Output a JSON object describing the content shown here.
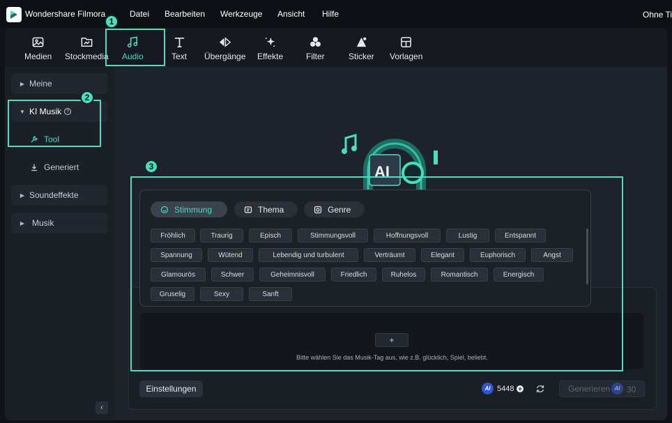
{
  "titlebar": {
    "app_title": "Wondershare Filmora",
    "menu": [
      "Datei",
      "Bearbeiten",
      "Werkzeuge",
      "Ansicht",
      "Hilfe"
    ],
    "right_title": "Ohne Tit"
  },
  "toolbar": {
    "items": [
      {
        "label": "Medien",
        "icon": "media-icon"
      },
      {
        "label": "Stockmedia",
        "icon": "stockmedia-icon"
      },
      {
        "label": "Audio",
        "icon": "music-note-icon",
        "active": true
      },
      {
        "label": "Text",
        "icon": "text-icon"
      },
      {
        "label": "Übergänge",
        "icon": "transition-icon"
      },
      {
        "label": "Effekte",
        "icon": "effects-icon"
      },
      {
        "label": "Filter",
        "icon": "filter-icon"
      },
      {
        "label": "Sticker",
        "icon": "sticker-icon"
      },
      {
        "label": "Vorlagen",
        "icon": "templates-icon"
      }
    ]
  },
  "sidebar": {
    "meine": "Meine",
    "ki_musik": "KI Musik",
    "tool": "Tool",
    "generiert": "Generiert",
    "soundeffekte": "Soundeffekte",
    "musik": "Musik"
  },
  "annotations": [
    "1",
    "2",
    "3"
  ],
  "popup": {
    "tabs": [
      {
        "label": "Stimmung",
        "active": true
      },
      {
        "label": "Thema"
      },
      {
        "label": "Genre"
      }
    ],
    "tags": [
      [
        "Fröhlich",
        "Traurig",
        "Episch",
        "Stimmungsvoll",
        "Hoffnungsvoll",
        "Lustig",
        "Entspannt"
      ],
      [
        "Spannung",
        "Wütend",
        "Lebendig und turbulent",
        "Verträumt",
        "Elegant",
        "Euphorisch",
        "Angst"
      ],
      [
        "Glamourös",
        "Schwer",
        "Geheimnisvoll",
        "Friedlich",
        "Ruhelos",
        "Romantisch",
        "Energisch"
      ],
      [
        "Gruselig",
        "Sexy",
        "Sanft"
      ]
    ]
  },
  "composer": {
    "plus": "+",
    "hint": "Bitte wählen Sie das Musik-Tag aus, wie z.B. glücklich, Spiel, beliebt.",
    "settings": "Einstellungen",
    "ai_badge": "AI",
    "credits": "5448",
    "generate": "Generieren",
    "generate_cost": "30"
  },
  "illustration_text": "AI",
  "colors": {
    "accent": "#46e0c1",
    "active_text": "#4ad8c7",
    "ai_coin": "#3054d8"
  }
}
